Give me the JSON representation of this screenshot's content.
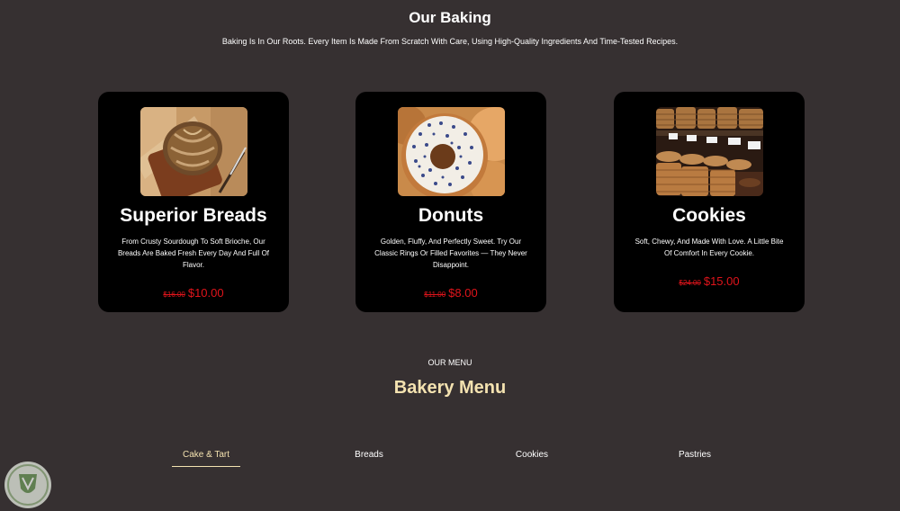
{
  "section": {
    "title": "Our Baking",
    "subtitle": "Baking Is In Our Roots. Every Item Is Made From Scratch With Care, Using High-Quality Ingredients And Time-Tested Recipes."
  },
  "cards": [
    {
      "title": "Superior Breads",
      "description": "From Crusty Sourdough To Soft Brioche, Our Breads Are Baked Fresh Every Day And Full Of Flavor.",
      "old_price": "$16.00",
      "price": "$10.00",
      "image": "bread-image"
    },
    {
      "title": "Donuts",
      "description": "Golden, Fluffy, And Perfectly Sweet. Try Our Classic Rings Or Filled Favorites — They Never Disappoint.",
      "old_price": "$11.00",
      "price": "$8.00",
      "image": "donut-image"
    },
    {
      "title": "Cookies",
      "description": "Soft, Chewy, And Made With Love. A Little Bite Of Comfort In Every Cookie.",
      "old_price": "$24.00",
      "price": "$15.00",
      "image": "cookies-image"
    }
  ],
  "menu": {
    "eyebrow": "OUR MENU",
    "title": "Bakery Menu",
    "tabs": [
      "Cake & Tart",
      "Breads",
      "Cookies",
      "Pastries"
    ],
    "active_tab": "Cake & Tart"
  },
  "colors": {
    "background": "#363031",
    "card": "#000000",
    "accent": "#f4e2b0",
    "price": "#e0141b"
  }
}
